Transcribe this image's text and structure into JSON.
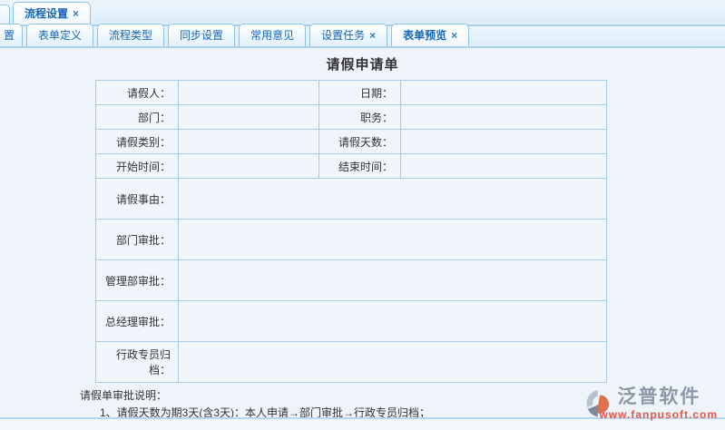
{
  "icons": {
    "close": "×"
  },
  "tabs_level1": {
    "items": [
      {
        "label": "流程设置",
        "closable": true,
        "active": true
      }
    ]
  },
  "tabs_level2": {
    "items": [
      {
        "label": "置",
        "partial": true
      },
      {
        "label": "表单定义"
      },
      {
        "label": "流程类型"
      },
      {
        "label": "同步设置"
      },
      {
        "label": "常用意见"
      },
      {
        "label": "设置任务",
        "closable": true
      },
      {
        "label": "表单预览",
        "closable": true,
        "active": true
      }
    ]
  },
  "form": {
    "title": "请假申请单",
    "rows_small": [
      {
        "label1": "请假人：",
        "value1": "",
        "label2": "日期：",
        "value2": ""
      },
      {
        "label1": "部门：",
        "value1": "",
        "label2": "职务：",
        "value2": ""
      },
      {
        "label1": "请假类别：",
        "value1": "",
        "label2": "请假天数：",
        "value2": ""
      },
      {
        "label1": "开始时间：",
        "value1": "",
        "label2": "结束时间：",
        "value2": ""
      }
    ],
    "rows_large": [
      {
        "label": "请假事由：",
        "value": ""
      },
      {
        "label": "部门审批：",
        "value": ""
      },
      {
        "label": "管理部审批：",
        "value": ""
      },
      {
        "label": "总经理审批：",
        "value": ""
      },
      {
        "label": "行政专员归档：",
        "value": ""
      }
    ],
    "notes": {
      "heading": "请假单审批说明：",
      "items": [
        "1、请假天数为期3天(含3天)：本人申请→部门审批→行政专员归档；"
      ]
    }
  },
  "footer": {
    "logo_name": "泛普软件",
    "logo_url": "www.fanpusoft.com"
  },
  "colors": {
    "accent_blue": "#1666b8",
    "table_border": "#a9c9e8",
    "cell_bg": "#f1f5fc",
    "logo_gray": "#8d97a8",
    "logo_red": "#e2574b",
    "logo_orange": "#e0714f"
  }
}
